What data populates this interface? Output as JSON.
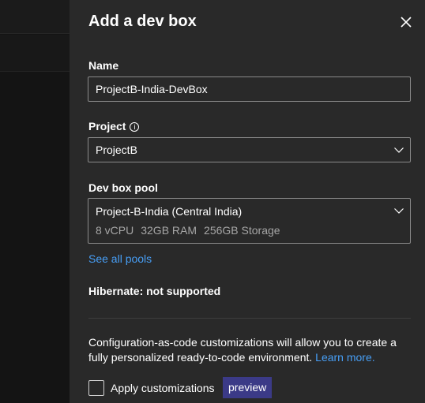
{
  "panel": {
    "title": "Add a dev box",
    "close_icon": "close-icon"
  },
  "name_field": {
    "label": "Name",
    "value": "ProjectB-India-DevBox"
  },
  "project_field": {
    "label": "Project",
    "info_glyph": "i",
    "value": "ProjectB"
  },
  "pool_field": {
    "label": "Dev box pool",
    "value": "Project-B-India (Central India)",
    "cpu": "8 vCPU",
    "ram": "32GB RAM",
    "storage": "256GB Storage"
  },
  "see_all_pools": "See all pools",
  "hibernate": "Hibernate: not supported",
  "customizations": {
    "description": "Configuration-as-code customizations will allow you to create a fully personalized ready-to-code environment.",
    "learn_more": "Learn more.",
    "checkbox_label": "Apply customizations",
    "checked": false,
    "badge": "preview"
  },
  "colors": {
    "panel_bg": "#292929",
    "link": "#479ef5",
    "badge_bg": "#3b3a87"
  }
}
